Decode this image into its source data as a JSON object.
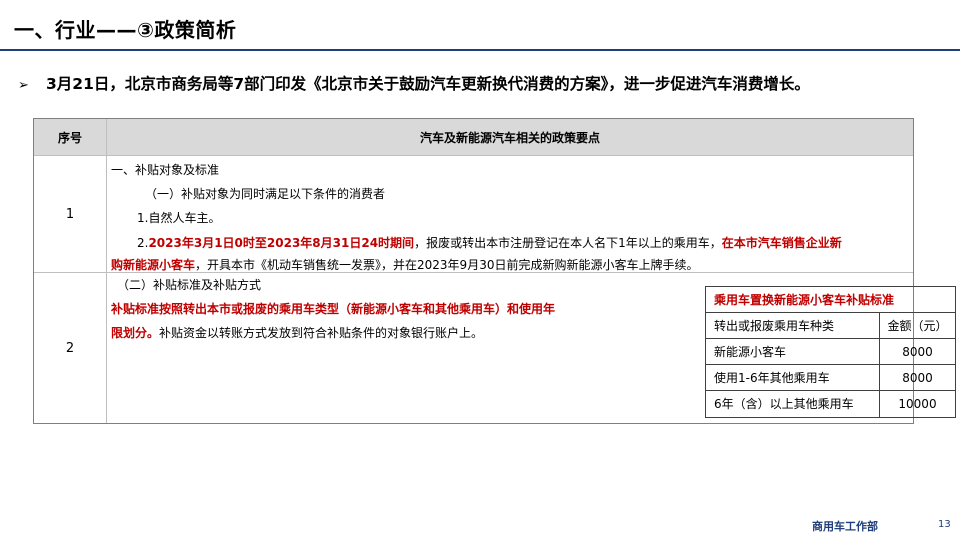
{
  "slide": {
    "title": "一、行业——③政策简析",
    "headline": "3月21日，北京市商务局等7部门印发《北京市关于鼓励汽车更新换代消费的方案》，进一步促进汽车消费增长。",
    "bullet_icon": "arrow-bullet-icon"
  },
  "table": {
    "col_headers": [
      "序号",
      "汽车及新能源汽车相关的政策要点"
    ],
    "row1": {
      "num": "1",
      "line1": "一、补贴对象及标准",
      "line2": "（一）补贴对象为同时满足以下条件的消费者",
      "line3": "1.自然人车主。",
      "line4_prefix": "2.",
      "line4_red": "2023年3月1日0时至2023年8月31日24时期间",
      "line4_black": "，报废或转出本市注册登记在本人名下1年以上的乘用车，",
      "line4_red2": "在本市汽车销售企业新",
      "line5_red": "购新能源小客车",
      "line5_black": "，开具本市《机动车销售统一发票》，并在2023年9月30日前完成新购新能源小客车上牌手续。"
    },
    "row2": {
      "num": "2",
      "line1": "（二）补贴标准及补贴方式",
      "line2_red": "补贴标准按照转出本市或报废的乘用车类型（新能源小客车和其他乘用车）和使用年",
      "line3_red": "限划分。",
      "line3_black": "补贴资金以转账方式发放到符合补贴条件的对象银行账户上。"
    }
  },
  "subsidy_table": {
    "caption": "乘用车置换新能源小客车补贴标准",
    "header": [
      "转出或报废乘用车种类",
      "金额（元）"
    ],
    "rows": [
      [
        "新能源小客车",
        "8000"
      ],
      [
        "使用1-6年其他乘用车",
        "8000"
      ],
      [
        "6年（含）以上其他乘用车",
        "10000"
      ]
    ]
  },
  "footer": {
    "dept": "商用车工作部",
    "page": "13"
  },
  "colors": {
    "accent": "#1f3f7a",
    "highlight_red": "#c00000",
    "header_gray": "#d9d9d9"
  }
}
